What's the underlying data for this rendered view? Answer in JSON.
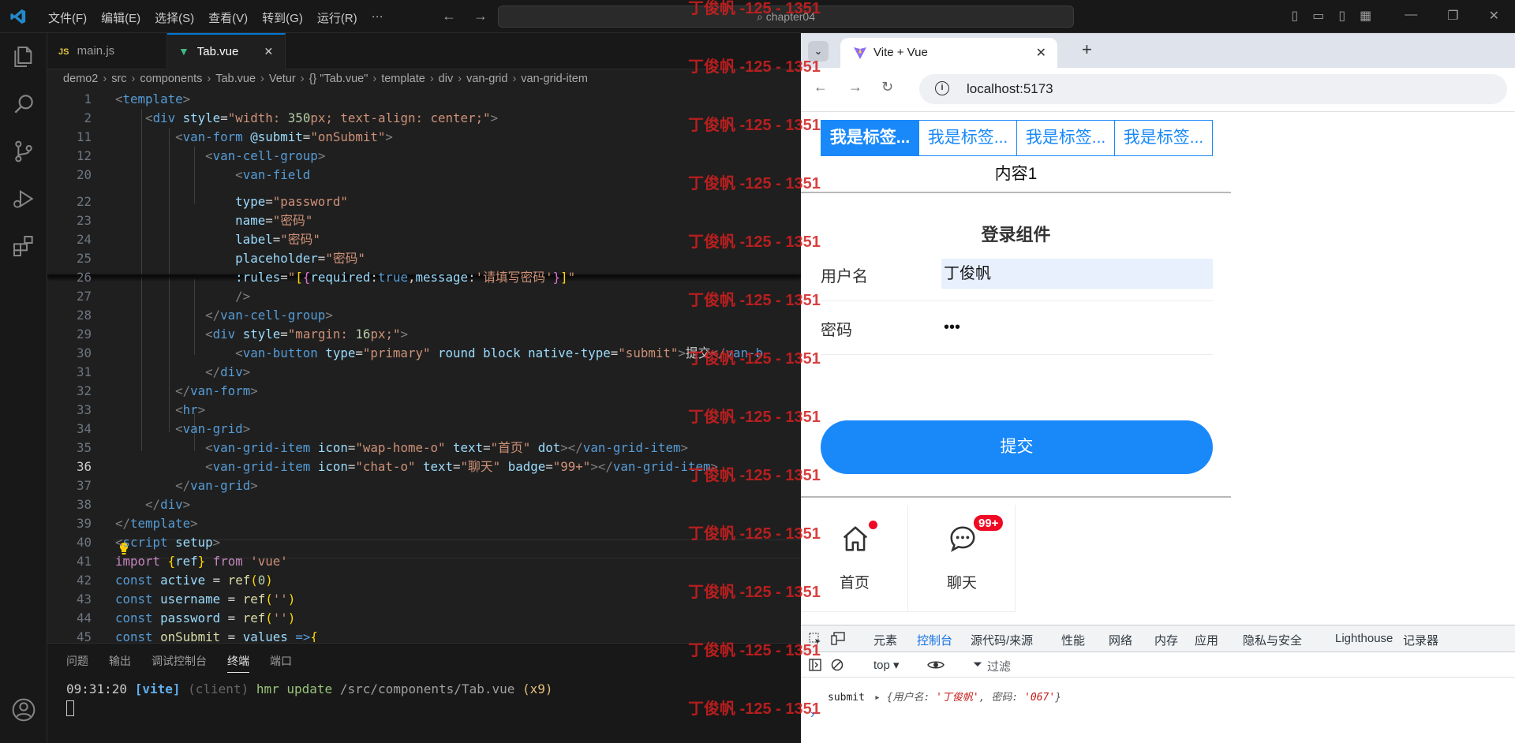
{
  "titlebar": {
    "menu": [
      "文件(F)",
      "编辑(E)",
      "选择(S)",
      "查看(V)",
      "转到(G)",
      "运行(R)",
      "···"
    ],
    "search_text": "chapter04"
  },
  "editor": {
    "tabs": [
      {
        "label": "main.js",
        "kind": "JS"
      },
      {
        "label": "Tab.vue",
        "kind": "vue"
      }
    ],
    "breadcrumb": [
      "demo2",
      "src",
      "components",
      "Tab.vue",
      "Vetur",
      "{} \"Tab.vue\"",
      "template",
      "div",
      "van-grid",
      "van-grid-item"
    ],
    "lines": [
      {
        "n": "1",
        "parts": [
          [
            "t",
            "<"
          ],
          [
            "tg",
            "template"
          ],
          [
            "t",
            ">"
          ]
        ]
      },
      {
        "n": "2",
        "parts": [
          [
            "pl",
            "    "
          ],
          [
            "t",
            "<"
          ],
          [
            "tg",
            "div"
          ],
          [
            "pl",
            " "
          ],
          [
            "at",
            "style"
          ],
          [
            "pl",
            "="
          ],
          [
            "st",
            "\"width: "
          ],
          [
            "nm",
            "350"
          ],
          [
            "st",
            "px; text-align: center;\""
          ],
          [
            "t",
            ">"
          ]
        ]
      },
      {
        "n": "11",
        "parts": [
          [
            "pl",
            "        "
          ],
          [
            "t",
            "<"
          ],
          [
            "tg",
            "van-form"
          ],
          [
            "pl",
            " "
          ],
          [
            "at",
            "@submit"
          ],
          [
            "pl",
            "="
          ],
          [
            "st",
            "\"onSubmit\""
          ],
          [
            "t",
            ">"
          ]
        ]
      },
      {
        "n": "12",
        "parts": [
          [
            "pl",
            "            "
          ],
          [
            "t",
            "<"
          ],
          [
            "tg",
            "van-cell-group"
          ],
          [
            "t",
            ">"
          ]
        ]
      },
      {
        "n": "20",
        "parts": [
          [
            "pl",
            "                "
          ],
          [
            "t",
            "<"
          ],
          [
            "tg",
            "van-field"
          ]
        ]
      },
      {
        "n": "22",
        "parts": [
          [
            "pl",
            "                "
          ],
          [
            "at",
            "type"
          ],
          [
            "pl",
            "="
          ],
          [
            "st",
            "\"password\""
          ]
        ]
      },
      {
        "n": "23",
        "parts": [
          [
            "pl",
            "                "
          ],
          [
            "at",
            "name"
          ],
          [
            "pl",
            "="
          ],
          [
            "st",
            "\"密码\""
          ]
        ]
      },
      {
        "n": "24",
        "parts": [
          [
            "pl",
            "                "
          ],
          [
            "at",
            "label"
          ],
          [
            "pl",
            "="
          ],
          [
            "st",
            "\"密码\""
          ]
        ]
      },
      {
        "n": "25",
        "parts": [
          [
            "pl",
            "                "
          ],
          [
            "at",
            "placeholder"
          ],
          [
            "pl",
            "="
          ],
          [
            "st",
            "\"密码\""
          ]
        ]
      },
      {
        "n": "26",
        "parts": [
          [
            "pl",
            "                "
          ],
          [
            "at",
            ":rules"
          ],
          [
            "pl",
            "="
          ],
          [
            "st",
            "\""
          ],
          [
            "br",
            "["
          ],
          [
            "br2",
            "{"
          ],
          [
            "vr",
            "required"
          ],
          [
            "pl",
            ":"
          ],
          [
            "kw",
            "true"
          ],
          [
            "pl",
            ","
          ],
          [
            "vr",
            "message"
          ],
          [
            "pl",
            ":"
          ],
          [
            "st",
            "'请填写密码'"
          ],
          [
            "br2",
            "}"
          ],
          [
            "br",
            "]"
          ],
          [
            "st",
            "\""
          ]
        ]
      },
      {
        "n": "27",
        "parts": [
          [
            "pl",
            "                "
          ],
          [
            "t",
            "/>"
          ]
        ]
      },
      {
        "n": "28",
        "parts": [
          [
            "pl",
            "            "
          ],
          [
            "t",
            "</"
          ],
          [
            "tg",
            "van-cell-group"
          ],
          [
            "t",
            ">"
          ]
        ]
      },
      {
        "n": "29",
        "parts": [
          [
            "pl",
            "            "
          ],
          [
            "t",
            "<"
          ],
          [
            "tg",
            "div"
          ],
          [
            "pl",
            " "
          ],
          [
            "at",
            "style"
          ],
          [
            "pl",
            "="
          ],
          [
            "st",
            "\"margin: "
          ],
          [
            "nm",
            "16"
          ],
          [
            "st",
            "px;\""
          ],
          [
            "t",
            ">"
          ]
        ]
      },
      {
        "n": "30",
        "parts": [
          [
            "pl",
            "                "
          ],
          [
            "t",
            "<"
          ],
          [
            "tg",
            "van-button"
          ],
          [
            "pl",
            " "
          ],
          [
            "at",
            "type"
          ],
          [
            "pl",
            "="
          ],
          [
            "st",
            "\"primary\""
          ],
          [
            "pl",
            " "
          ],
          [
            "at",
            "round"
          ],
          [
            "pl",
            " "
          ],
          [
            "at",
            "block"
          ],
          [
            "pl",
            " "
          ],
          [
            "at",
            "native-type"
          ],
          [
            "pl",
            "="
          ],
          [
            "st",
            "\"submit\""
          ],
          [
            "t",
            ">"
          ],
          [
            "pl",
            "提交"
          ],
          [
            "t",
            "</"
          ],
          [
            "tg",
            "van-b"
          ]
        ]
      },
      {
        "n": "31",
        "parts": [
          [
            "pl",
            "            "
          ],
          [
            "t",
            "</"
          ],
          [
            "tg",
            "div"
          ],
          [
            "t",
            ">"
          ]
        ]
      },
      {
        "n": "32",
        "parts": [
          [
            "pl",
            "        "
          ],
          [
            "t",
            "</"
          ],
          [
            "tg",
            "van-form"
          ],
          [
            "t",
            ">"
          ]
        ]
      },
      {
        "n": "33",
        "parts": [
          [
            "pl",
            "        "
          ],
          [
            "t",
            "<"
          ],
          [
            "tg",
            "hr"
          ],
          [
            "t",
            ">"
          ]
        ]
      },
      {
        "n": "34",
        "parts": [
          [
            "pl",
            "        "
          ],
          [
            "t",
            "<"
          ],
          [
            "tg",
            "van-grid"
          ],
          [
            "t",
            ">"
          ]
        ]
      },
      {
        "n": "35",
        "parts": [
          [
            "pl",
            "            "
          ],
          [
            "t",
            "<"
          ],
          [
            "tg",
            "van-grid-item"
          ],
          [
            "pl",
            " "
          ],
          [
            "at",
            "icon"
          ],
          [
            "pl",
            "="
          ],
          [
            "st",
            "\"wap-home-o\""
          ],
          [
            "pl",
            " "
          ],
          [
            "at",
            "text"
          ],
          [
            "pl",
            "="
          ],
          [
            "st",
            "\"首页\""
          ],
          [
            "pl",
            " "
          ],
          [
            "at",
            "dot"
          ],
          [
            "t",
            "></"
          ],
          [
            "tg",
            "van-grid-item"
          ],
          [
            "t",
            ">"
          ]
        ]
      },
      {
        "n": "36",
        "parts": [
          [
            "pl",
            "            "
          ],
          [
            "t",
            "<"
          ],
          [
            "tg",
            "van-grid-item"
          ],
          [
            "pl",
            " "
          ],
          [
            "at",
            "icon"
          ],
          [
            "pl",
            "="
          ],
          [
            "st",
            "\"chat-o\""
          ],
          [
            "pl",
            " "
          ],
          [
            "at",
            "text"
          ],
          [
            "pl",
            "="
          ],
          [
            "st",
            "\"聊天\""
          ],
          [
            "pl",
            " "
          ],
          [
            "at",
            "badge"
          ],
          [
            "pl",
            "="
          ],
          [
            "st",
            "\"99+\""
          ],
          [
            "t",
            "></"
          ],
          [
            "tg",
            "van-grid-item"
          ],
          [
            "t",
            ">"
          ]
        ]
      },
      {
        "n": "37",
        "parts": [
          [
            "pl",
            "        "
          ],
          [
            "t",
            "</"
          ],
          [
            "tg",
            "van-grid"
          ],
          [
            "t",
            ">"
          ]
        ]
      },
      {
        "n": "38",
        "parts": [
          [
            "pl",
            "    "
          ],
          [
            "t",
            "</"
          ],
          [
            "tg",
            "div"
          ],
          [
            "t",
            ">"
          ]
        ]
      },
      {
        "n": "39",
        "parts": [
          [
            "t",
            "</"
          ],
          [
            "tg",
            "template"
          ],
          [
            "t",
            ">"
          ]
        ]
      },
      {
        "n": "40",
        "parts": [
          [
            "t",
            "<"
          ],
          [
            "tg",
            "script"
          ],
          [
            "pl",
            " "
          ],
          [
            "at",
            "setup"
          ],
          [
            "t",
            ">"
          ]
        ]
      },
      {
        "n": "41",
        "parts": [
          [
            "kp",
            "import"
          ],
          [
            "pl",
            " "
          ],
          [
            "br",
            "{"
          ],
          [
            "vr",
            "ref"
          ],
          [
            "br",
            "}"
          ],
          [
            "pl",
            " "
          ],
          [
            "kp",
            "from"
          ],
          [
            "pl",
            " "
          ],
          [
            "st",
            "'vue'"
          ]
        ]
      },
      {
        "n": "42",
        "parts": [
          [
            "kw",
            "const"
          ],
          [
            "pl",
            " "
          ],
          [
            "vr",
            "active"
          ],
          [
            "pl",
            " = "
          ],
          [
            "fn",
            "ref"
          ],
          [
            "br",
            "("
          ],
          [
            "nm",
            "0"
          ],
          [
            "br",
            ")"
          ]
        ]
      },
      {
        "n": "43",
        "parts": [
          [
            "kw",
            "const"
          ],
          [
            "pl",
            " "
          ],
          [
            "vr",
            "username"
          ],
          [
            "pl",
            " = "
          ],
          [
            "fn",
            "ref"
          ],
          [
            "br",
            "("
          ],
          [
            "st",
            "''"
          ],
          [
            "br",
            ")"
          ]
        ]
      },
      {
        "n": "44",
        "parts": [
          [
            "kw",
            "const"
          ],
          [
            "pl",
            " "
          ],
          [
            "vr",
            "password"
          ],
          [
            "pl",
            " = "
          ],
          [
            "fn",
            "ref"
          ],
          [
            "br",
            "("
          ],
          [
            "st",
            "''"
          ],
          [
            "br",
            ")"
          ]
        ]
      },
      {
        "n": "45",
        "parts": [
          [
            "kw",
            "const"
          ],
          [
            "pl",
            " "
          ],
          [
            "fn",
            "onSubmit"
          ],
          [
            "pl",
            " = "
          ],
          [
            "vr",
            "values"
          ],
          [
            "pl",
            " "
          ],
          [
            "kw",
            "=>"
          ],
          [
            "br",
            "{"
          ]
        ]
      }
    ]
  },
  "panel": {
    "tabs": [
      "问题",
      "输出",
      "调试控制台",
      "终端",
      "端口"
    ],
    "active_tab": "终端",
    "terminal": {
      "time": "09:31:20",
      "tag": "[vite]",
      "client": "(client)",
      "action": "hmr update",
      "path": "/src/components/Tab.vue",
      "count": "(x9)"
    }
  },
  "watermark": "丁俊帆 -125 - 1351",
  "browser": {
    "tab_title": "Vite + Vue",
    "url": "localhost:5173",
    "page": {
      "tabs": [
        "我是标签...",
        "我是标签...",
        "我是标签...",
        "我是标签..."
      ],
      "tab_content": "内容1",
      "login_title": "登录组件",
      "username_label": "用户名",
      "username_value": "丁俊帆",
      "password_label": "密码",
      "password_value": "•••",
      "submit_label": "提交",
      "grid": [
        {
          "text": "首页",
          "icon": "home-icon",
          "dot": true
        },
        {
          "text": "聊天",
          "icon": "chat-icon",
          "badge": "99+"
        }
      ]
    },
    "devtools": {
      "tabs": [
        "元素",
        "控制台",
        "源代码/来源",
        "性能",
        "网络",
        "内存",
        "应用",
        "隐私与安全",
        "Lighthouse",
        "记录器"
      ],
      "active_tab": "控制台",
      "context": "top",
      "filter_placeholder": "过滤",
      "console": {
        "label": "submit",
        "obj_open": "{用户名: ",
        "username": "'丁俊帆'",
        "mid": ", 密码: ",
        "password": "'067'",
        "obj_close": "}"
      }
    }
  },
  "colors": {
    "vant_primary": "#1989fa",
    "vant_danger": "#ee0a24",
    "vscode_accent": "#0078d4"
  }
}
